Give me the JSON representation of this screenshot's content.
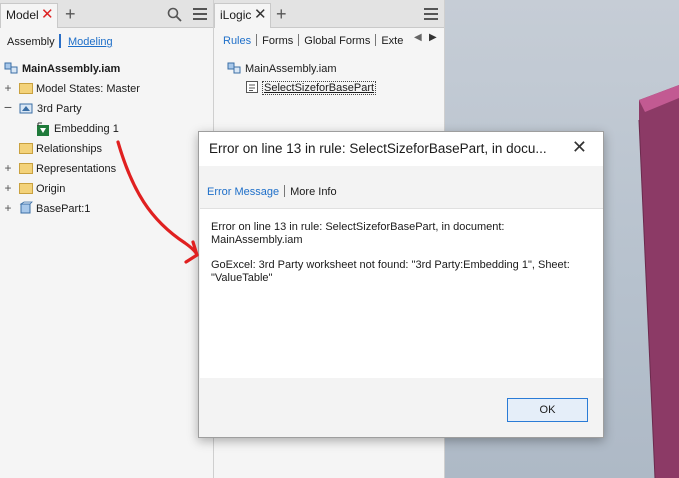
{
  "model_panel": {
    "tab_label": "Model",
    "subtabs": [
      "Assembly",
      "Modeling"
    ],
    "tree": {
      "root": "MainAssembly.iam",
      "model_states": "Model States: Master",
      "third_party": "3rd Party",
      "embedding": "Embedding 1",
      "relationships": "Relationships",
      "representations": "Representations",
      "origin": "Origin",
      "basepart": "BasePart:1"
    }
  },
  "ilogic_panel": {
    "tab_label": "iLogic",
    "subtabs": [
      "Rules",
      "Forms",
      "Global Forms",
      "Exte"
    ],
    "tree": {
      "root": "MainAssembly.iam",
      "rule": "SelectSizeforBasePart"
    }
  },
  "dialog": {
    "title": "Error on line 13 in rule: SelectSizeforBasePart, in docu...",
    "tabs": [
      "Error Message",
      "More Info"
    ],
    "message_line1": "Error on line 13 in rule: SelectSizeforBasePart, in document: MainAssembly.iam",
    "message_line2": "GoExcel: 3rd Party worksheet not found: \"3rd Party:Embedding 1\", Sheet: \"ValueTable\"",
    "ok_label": "OK"
  },
  "colors": {
    "accent": "#1e6fc9",
    "annotation": "#e02020",
    "model_face": "#8c3a66",
    "model_top": "#c25a92"
  }
}
